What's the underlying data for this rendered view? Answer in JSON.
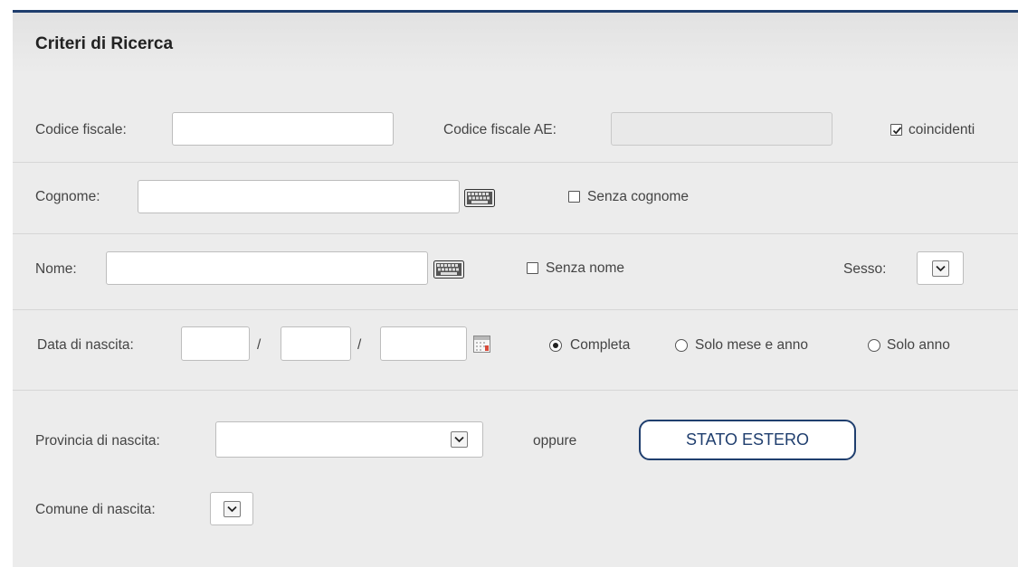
{
  "panel": {
    "title": "Criteri di Ricerca"
  },
  "row_codice": {
    "codice_fiscale_label": "Codice fiscale:",
    "codice_fiscale_value": "",
    "codice_fiscale_ae_label": "Codice fiscale AE:",
    "codice_fiscale_ae_value": "",
    "coincidenti_label": "coincidenti",
    "coincidenti_checked": true
  },
  "row_cognome": {
    "label": "Cognome:",
    "value": "",
    "senza_label": "Senza cognome",
    "senza_checked": false
  },
  "row_nome": {
    "label": "Nome:",
    "value": "",
    "senza_label": "Senza nome",
    "senza_checked": false,
    "sesso_label": "Sesso:",
    "sesso_value": ""
  },
  "row_data": {
    "label": "Data di nascita:",
    "separator1": "/",
    "separator2": "/",
    "day": "",
    "month": "",
    "year": "",
    "options": [
      "Completa",
      "Solo mese e anno",
      "Solo anno"
    ],
    "selected": "Completa"
  },
  "row_provincia": {
    "label": "Provincia di nascita:",
    "value": "",
    "oppure_label": "oppure",
    "stato_estero_button": "STATO ESTERO"
  },
  "row_comune": {
    "label": "Comune di nascita:",
    "value": ""
  },
  "icons": {
    "keyboard": "keyboard-icon",
    "calendar": "calendar-icon",
    "dropdown": "chevron-down-icon",
    "check": "check-icon"
  },
  "colors": {
    "accent": "#1f3e6e",
    "panel_bg": "#ececec"
  }
}
